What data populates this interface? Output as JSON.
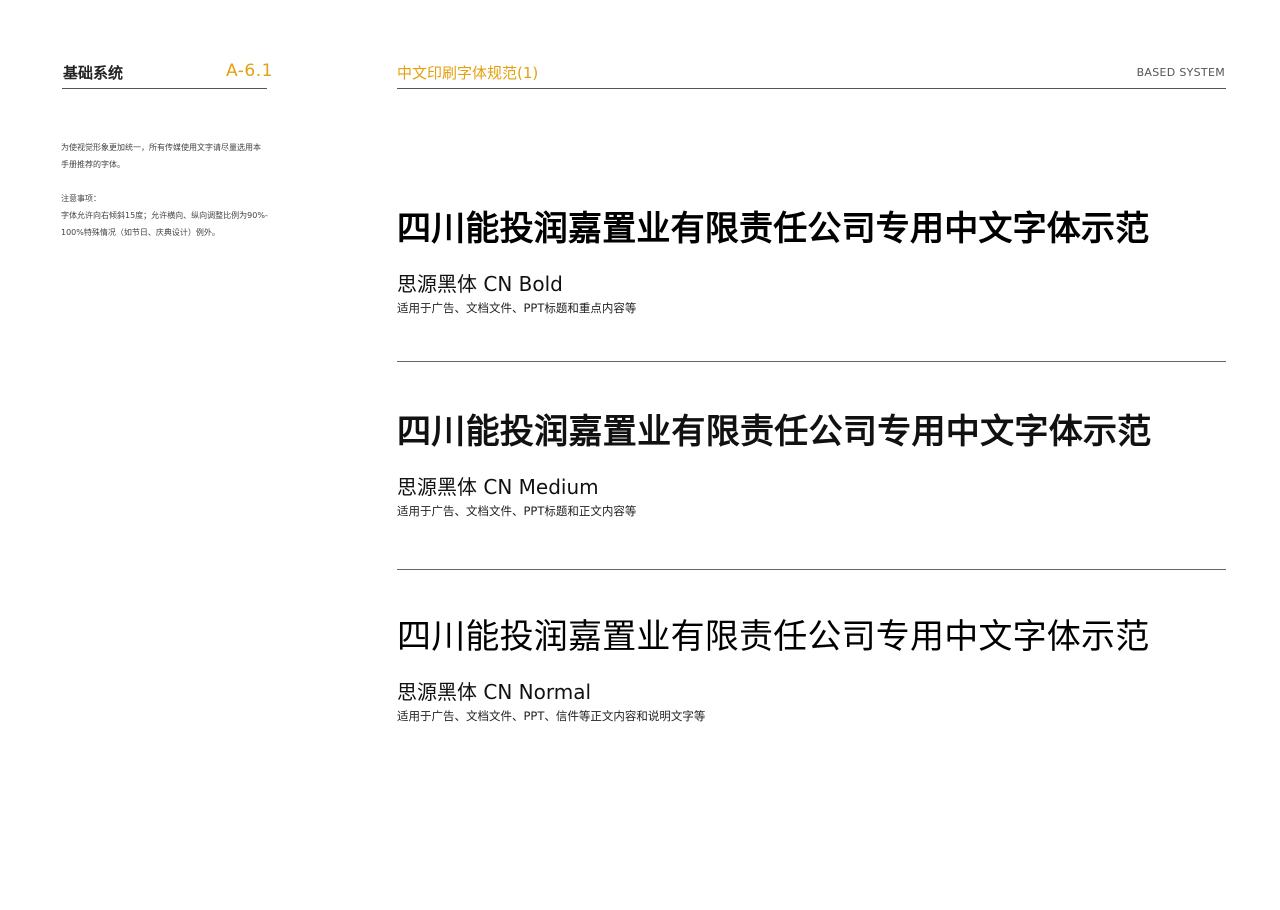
{
  "sidebar": {
    "title": "基础系统",
    "code": "A-6.1",
    "intro_line1": "为使视觉形象更加统一，所有传媒使用文字请尽量选用本",
    "intro_line2": "手册推荐的字体。",
    "notes_heading": "注意事项：",
    "notes_line1": "字体允许向右倾斜15度；允许横向、纵向调整比例为90%-",
    "notes_line2": "100%特殊情况（如节日、庆典设计）例外。"
  },
  "header": {
    "title": "中文印刷字体规范(1)",
    "brand": "BASED SYSTEM"
  },
  "sections": [
    {
      "sample": "四川能投润嘉置业有限责任公司专用中文字体示范",
      "font_name": "思源黑体 CN Bold",
      "usage": "适用于广告、文档文件、PPT标题和重点内容等"
    },
    {
      "sample": "四川能投润嘉置业有限责任公司专用中文字体示范",
      "font_name": "思源黑体 CN Medium",
      "usage": "适用于广告、文档文件、PPT标题和正文内容等"
    },
    {
      "sample": "四川能投润嘉置业有限责任公司专用中文字体示范",
      "font_name": "思源黑体 CN Normal",
      "usage": "适用于广告、文档文件、PPT、信件等正文内容和说明文字等"
    }
  ],
  "colors": {
    "accent": "#e5a010",
    "text": "#111111",
    "rule": "#555555"
  }
}
